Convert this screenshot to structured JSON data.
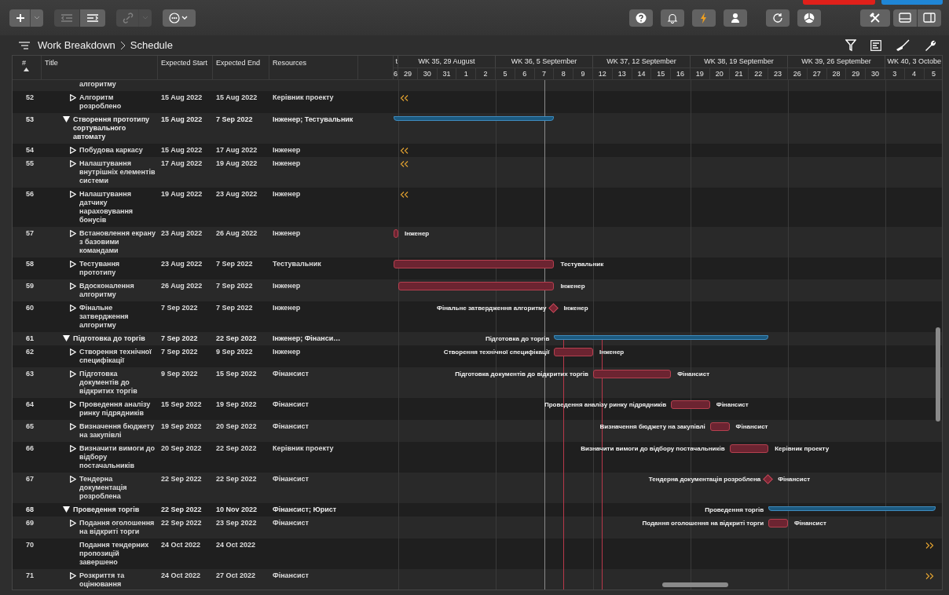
{
  "toolbar": {
    "left": [
      {
        "kind": "add",
        "disabled": false
      },
      {
        "kind": "outdent",
        "disabled": true
      },
      {
        "kind": "indent",
        "disabled": false
      },
      {
        "kind": "link",
        "disabled": true
      },
      {
        "kind": "more",
        "disabled": false
      }
    ],
    "right_groups": [
      [
        {
          "kind": "help"
        },
        {
          "kind": "bell"
        },
        {
          "kind": "bolt"
        },
        {
          "kind": "person"
        }
      ],
      [
        {
          "kind": "refresh"
        },
        {
          "kind": "pie"
        }
      ],
      [
        {
          "kind": "tools"
        },
        {
          "kind": "layout"
        }
      ]
    ]
  },
  "breadcrumb": [
    "Work Breakdown",
    "Schedule"
  ],
  "view_tools": [
    {
      "kind": "filter"
    },
    {
      "kind": "outline"
    },
    {
      "kind": "broom"
    },
    {
      "kind": "wrench"
    }
  ],
  "table": {
    "columns": [
      {
        "label": "#",
        "sorted": true
      },
      {
        "label": "Title",
        "sorted": false
      },
      {
        "label": "Expected Start",
        "sorted": false
      },
      {
        "label": "Expected End",
        "sorted": false
      },
      {
        "label": "Resources",
        "sorted": false
      }
    ],
    "rows": [
      {
        "kind": "continuation",
        "title": "алгоритму"
      },
      {
        "id": "52",
        "kind": "task",
        "title": "Алгоритм розроблено",
        "start": "15 Aug 2022",
        "end": "15 Aug 2022",
        "resources": "Керівник проекту",
        "bar": {
          "kind": "arrow_left"
        }
      },
      {
        "id": "53",
        "kind": "summary",
        "expanded": true,
        "title": "Створення прототипу сортувального автомату",
        "start": "15 Aug 2022",
        "end": "7 Sep 2022",
        "resources": "Інженер; Тестувальник",
        "bar": {
          "kind": "summary"
        }
      },
      {
        "id": "54",
        "kind": "task",
        "title": "Побудова каркасу",
        "start": "15 Aug 2022",
        "end": "17 Aug 2022",
        "resources": "Інженер",
        "bar": {
          "kind": "arrow_left"
        }
      },
      {
        "id": "55",
        "kind": "task",
        "title": "Налаштування внутрішніх елементів системи",
        "start": "17 Aug 2022",
        "end": "19 Aug 2022",
        "resources": "Інженер",
        "bar": {
          "kind": "arrow_left"
        }
      },
      {
        "id": "56",
        "kind": "task",
        "title": "Налаштування датчику нараховування бонусів",
        "start": "19 Aug 2022",
        "end": "23 Aug 2022",
        "resources": "Інженер",
        "bar": {
          "kind": "arrow_left"
        }
      },
      {
        "id": "57",
        "kind": "task",
        "title": "Встановлення екрану з базовими командами",
        "start": "23 Aug 2022",
        "end": "26 Aug 2022",
        "resources": "Інженер",
        "bar": {
          "kind": "task",
          "label_right": "Інженер"
        }
      },
      {
        "id": "58",
        "kind": "task",
        "title": "Тестування прототипу",
        "start": "23 Aug 2022",
        "end": "7 Sep 2022",
        "resources": "Тестувальник",
        "bar": {
          "kind": "task",
          "label_right": "Тестувальник"
        }
      },
      {
        "id": "59",
        "kind": "task",
        "title": "Вдосконалення алгоритму",
        "start": "26 Aug 2022",
        "end": "7 Sep 2022",
        "resources": "Інженер",
        "bar": {
          "kind": "task",
          "label_right": "Інженер"
        }
      },
      {
        "id": "60",
        "kind": "task",
        "title": "Фінальне затвердження алгоритму",
        "start": "7 Sep 2022",
        "end": "7 Sep 2022",
        "resources": "Інженер",
        "bar": {
          "kind": "milestone",
          "label_left": "Фінальне затвердження алгоритму",
          "label_right": "Інженер"
        }
      },
      {
        "id": "61",
        "kind": "summary",
        "expanded": true,
        "title": "Підготовка до торгів",
        "start": "7 Sep 2022",
        "end": "22 Sep 2022",
        "resources": "Інженер; Фінанси…",
        "bar": {
          "kind": "summary",
          "label_left": "Підготовка до торгів"
        }
      },
      {
        "id": "62",
        "kind": "task",
        "title": "Створення технічної специфікації",
        "start": "7 Sep 2022",
        "end": "9 Sep 2022",
        "resources": "Інженер",
        "bar": {
          "kind": "task",
          "label_left": "Створення технічної специфікації",
          "label_right": "Інженер"
        }
      },
      {
        "id": "63",
        "kind": "task",
        "title": "Підготовка документів до відкритих торгів",
        "start": "9 Sep 2022",
        "end": "15 Sep 2022",
        "resources": "Фінансист",
        "bar": {
          "kind": "task",
          "label_left": "Підготовка документів до відкритих торгів",
          "label_right": "Фінансист"
        }
      },
      {
        "id": "64",
        "kind": "task",
        "title": "Проведення аналізу ринку підрядників",
        "start": "15 Sep 2022",
        "end": "19 Sep 2022",
        "resources": "Фінансист",
        "bar": {
          "kind": "task",
          "label_left": "Проведення аналізу ринку підрядників",
          "label_right": "Фінансист"
        }
      },
      {
        "id": "65",
        "kind": "task",
        "title": "Визначення бюджету на закупівлі",
        "start": "19 Sep 2022",
        "end": "20 Sep 2022",
        "resources": "Фінансист",
        "bar": {
          "kind": "task",
          "label_left": "Визначення бюджету на закупівлі",
          "label_right": "Фінансист"
        }
      },
      {
        "id": "66",
        "kind": "task",
        "title": "Визначити вимоги до відбору постачальників",
        "start": "20 Sep 2022",
        "end": "22 Sep 2022",
        "resources": "Керівник проекту",
        "bar": {
          "kind": "task",
          "label_left": "Визначити вимоги до відбору постачальників",
          "label_right": "Керівник проекту"
        }
      },
      {
        "id": "67",
        "kind": "task",
        "title": "Тендерна документація розроблена",
        "start": "22 Sep 2022",
        "end": "22 Sep 2022",
        "resources": "Фінансист",
        "bar": {
          "kind": "milestone",
          "label_left": "Тендерна документація розроблена",
          "label_right": "Фінансист"
        }
      },
      {
        "id": "68",
        "kind": "summary",
        "expanded": true,
        "title": "Проведення торгів",
        "start": "22 Sep 2022",
        "end": "10 Nov 2022",
        "resources": "Фінансист; Юрист",
        "bar": {
          "kind": "summary",
          "label_left": "Проведення торгів"
        }
      },
      {
        "id": "69",
        "kind": "task",
        "title": "Подання оголошення на відкриті торги",
        "start": "22 Sep 2022",
        "end": "23 Sep 2022",
        "resources": "Фінансист",
        "bar": {
          "kind": "task",
          "label_left": "Подання оголошення на відкриті торги",
          "label_right": "Фінансист"
        }
      },
      {
        "id": "70",
        "kind": "plain",
        "title": "Подання тендерних пропозицій завершено",
        "start": "24 Oct 2022",
        "end": "24 Oct 2022",
        "bar": {
          "kind": "arrow_right"
        }
      },
      {
        "id": "71",
        "kind": "task",
        "title": "Розкриття та оцінювання",
        "start": "24 Oct 2022",
        "end": "27 Oct 2022",
        "resources": "Фінансист",
        "bar": {
          "kind": "arrow_right"
        }
      }
    ]
  },
  "timeline": {
    "weeks": [
      {
        "label": "t",
        "days": [
          "6"
        ]
      },
      {
        "label": "WK 35, 29 August",
        "days": [
          "29",
          "30",
          "31",
          "1",
          "2"
        ]
      },
      {
        "label": "WK 36, 5 September",
        "days": [
          "5",
          "6",
          "7",
          "8",
          "9"
        ]
      },
      {
        "label": "WK 37, 12 September",
        "days": [
          "12",
          "13",
          "14",
          "15",
          "16"
        ]
      },
      {
        "label": "WK 38, 19 September",
        "days": [
          "19",
          "20",
          "21",
          "22",
          "23"
        ]
      },
      {
        "label": "WK 39, 26 September",
        "days": [
          "26",
          "27",
          "28",
          "29",
          "30"
        ]
      },
      {
        "label": "WK 40, 3 Octobe",
        "days": [
          "3",
          "4",
          "5"
        ]
      }
    ]
  }
}
